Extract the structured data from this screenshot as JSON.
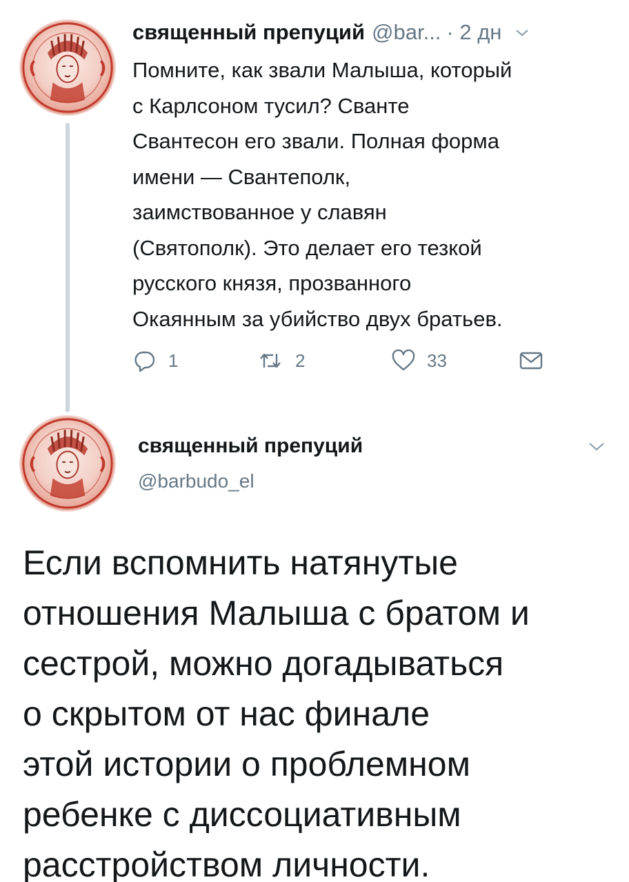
{
  "tweet1": {
    "display_name": "священный препуций",
    "handle": "@bar...",
    "time": "· 2 дн",
    "body_lines": [
      "Помните, как звали Малыша, который",
      "с Карлсоном тусил? Сванте",
      "Свантесон его звали. Полная форма",
      "имени — Свантеполк,",
      "заимствованное у славян",
      "(Святополк). Это делает его тезкой",
      "русского князя, прозванного",
      "Окаянным за убийство двух братьев."
    ],
    "actions": {
      "replies": "1",
      "retweets": "2",
      "likes": "33"
    }
  },
  "tweet2": {
    "display_name": "священный препуций",
    "handle": "@barbudo_el",
    "body_lines": [
      "Если вспомнить натянутые",
      "отношения Малыша с братом и",
      "сестрой, можно догадываться",
      "о скрытом от нас финале",
      "этой истории о проблемном",
      "ребенке с диссоциативным",
      "расстройством личности."
    ]
  },
  "icons": {
    "reply": "reply-icon",
    "retweet": "retweet-icon",
    "like": "heart-icon",
    "dm": "envelope-icon",
    "caret": "chevron-down-icon"
  },
  "colors": {
    "text": "#14171a",
    "secondary": "#657786",
    "thread_line": "#ccd6dd",
    "avatar_red": "#c0392b"
  }
}
